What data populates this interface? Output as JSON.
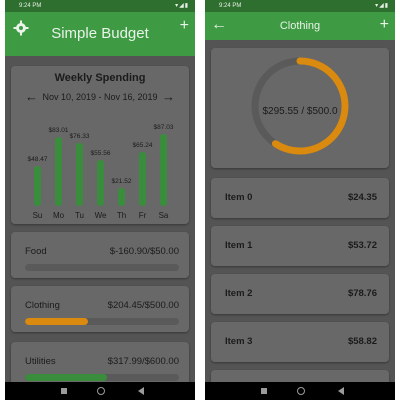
{
  "left": {
    "status_time": "9:24 PM",
    "app_title": "Simple Budget",
    "add_icon": "+",
    "settings_icon": "gear-icon",
    "weekly": {
      "title": "Weekly Spending",
      "range": "Nov 10, 2019 - Nov 16, 2019",
      "prev_icon": "arrow-left-icon",
      "next_icon": "arrow-right-icon",
      "bar_color": "#3a8d3c",
      "days": [
        {
          "day": "Su",
          "label": "$48.47",
          "value": 48.47
        },
        {
          "day": "Mo",
          "label": "$83.01",
          "value": 83.01
        },
        {
          "day": "Tu",
          "label": "$76.33",
          "value": 76.33
        },
        {
          "day": "We",
          "label": "$55.56",
          "value": 55.56
        },
        {
          "day": "Th",
          "label": "$21.52",
          "value": 21.52
        },
        {
          "day": "Fr",
          "label": "$65.24",
          "value": 65.24
        },
        {
          "day": "Sa",
          "label": "$87.03",
          "value": 87.03
        }
      ]
    },
    "categories": [
      {
        "name": "Food",
        "amount": "$-160.90/$50.00",
        "progress": 0,
        "color": "#3a8d3c"
      },
      {
        "name": "Clothing",
        "amount": "$204.45/$500.00",
        "progress": 0.41,
        "color": "#d98a0f"
      },
      {
        "name": "Utilities",
        "amount": "$317.99/$600.00",
        "progress": 0.53,
        "color": "#3a8d3c"
      }
    ]
  },
  "right": {
    "status_time": "9:24 PM",
    "app_title": "Clothing",
    "back_icon": "←",
    "add_icon": "+",
    "donut": {
      "label": "$295.55 / $500.0",
      "fraction": 0.591,
      "ring_color": "#d98a0f",
      "track_color": "#5a5a5a"
    },
    "items": [
      {
        "name": "Item 0",
        "amount": "$24.35"
      },
      {
        "name": "Item 1",
        "amount": "$53.72"
      },
      {
        "name": "Item 2",
        "amount": "$78.76"
      },
      {
        "name": "Item 3",
        "amount": "$58.82"
      }
    ]
  }
}
